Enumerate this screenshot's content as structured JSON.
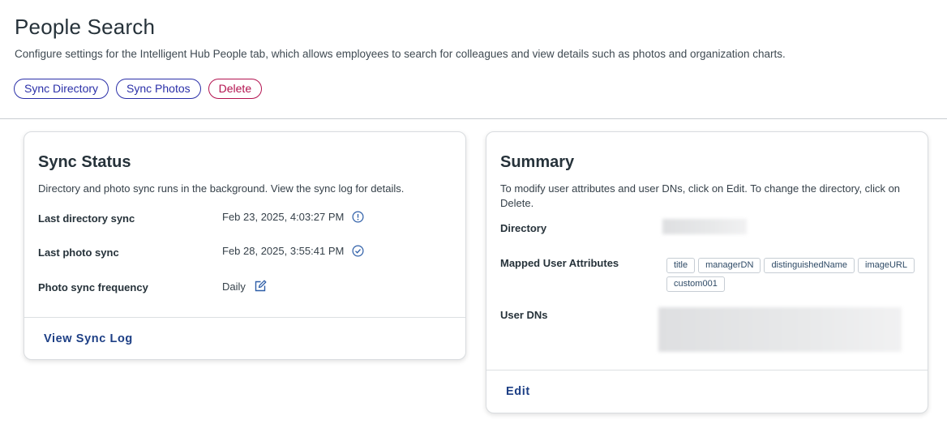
{
  "page": {
    "title": "People Search",
    "description": "Configure settings for the Intelligent Hub People tab, which allows employees to search for colleagues and view details such as photos and organization charts."
  },
  "actions": {
    "sync_directory": "Sync Directory",
    "sync_photos": "Sync Photos",
    "delete": "Delete"
  },
  "sync_status": {
    "title": "Sync Status",
    "description": "Directory and photo sync runs in the background. View the sync log for details.",
    "rows": [
      {
        "label": "Last directory sync",
        "value": "Feb 23, 2025, 4:03:27 PM",
        "icon": "info-circle-icon"
      },
      {
        "label": "Last photo sync",
        "value": "Feb 28, 2025, 3:55:41 PM",
        "icon": "check-circle-icon"
      },
      {
        "label": "Photo sync frequency",
        "value": "Daily",
        "icon": "edit-icon"
      }
    ],
    "view_log": "View Sync Log"
  },
  "summary": {
    "title": "Summary",
    "description": "To modify user attributes and user DNs, click on Edit. To change the directory, click on Delete.",
    "directory_label": "Directory",
    "attributes_label": "Mapped User Attributes",
    "attributes": [
      "title",
      "managerDN",
      "distinguishedName",
      "imageURL",
      "custom001"
    ],
    "user_dns_label": "User DNs",
    "edit": "Edit"
  },
  "colors": {
    "accent_blue": "#2a2fa8",
    "danger": "#b3124f",
    "link": "#1d3f85",
    "icon_blue": "#2f5fa8"
  }
}
